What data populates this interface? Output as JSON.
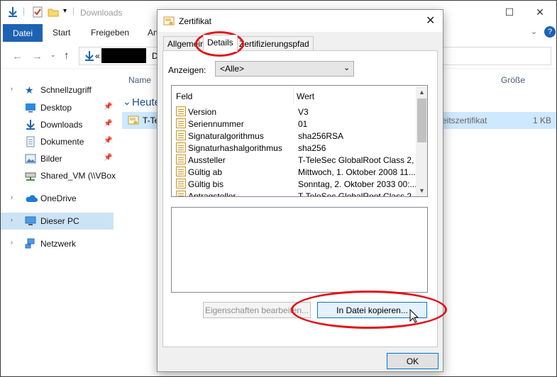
{
  "explorer": {
    "title": "Downloads",
    "ribbon_tabs": [
      "Datei",
      "Start",
      "Freigeben",
      "An"
    ],
    "address_prefix": "«",
    "address_rest": "D",
    "columns": {
      "name": "Name",
      "size": "Größe"
    },
    "group": "Heute",
    "file": {
      "name": "T-Te",
      "type": "eitszertifikat",
      "size": "1 KB"
    },
    "sidebar": [
      {
        "label": "Schnellzugriff",
        "pinned": false
      },
      {
        "label": "Desktop",
        "pinned": true
      },
      {
        "label": "Downloads",
        "pinned": true
      },
      {
        "label": "Dokumente",
        "pinned": true
      },
      {
        "label": "Bilder",
        "pinned": true
      },
      {
        "label": "Shared_VM (\\\\VBox",
        "pinned": false
      },
      {
        "label": "OneDrive",
        "pinned": false
      },
      {
        "label": "Dieser PC",
        "pinned": false
      },
      {
        "label": "Netzwerk",
        "pinned": false
      }
    ],
    "accent": "#1e62b4"
  },
  "dialog": {
    "title": "Zertifikat",
    "tabs": [
      "Allgemein",
      "Details",
      "Zertifizierungspfad"
    ],
    "active_tab": "Details",
    "show_label": "Anzeigen:",
    "show_value": "<Alle>",
    "list_headers": {
      "field": "Feld",
      "value": "Wert"
    },
    "rows": [
      {
        "field": "Version",
        "value": "V3"
      },
      {
        "field": "Seriennummer",
        "value": "01"
      },
      {
        "field": "Signaturalgorithmus",
        "value": "sha256RSA"
      },
      {
        "field": "Signaturhashalgorithmus",
        "value": "sha256"
      },
      {
        "field": "Aussteller",
        "value": "T-TeleSec GlobalRoot Class 2, ..."
      },
      {
        "field": "Gültig ab",
        "value": "Mittwoch, 1. Oktober 2008 11..."
      },
      {
        "field": "Gültig bis",
        "value": "Sonntag, 2. Oktober 2033 00:..."
      },
      {
        "field": "Antragsteller",
        "value": "T-TeleSec GlobalRoot Class 2, ..."
      }
    ],
    "btn_properties": "Eigenschaften bearbeiten...",
    "btn_copy": "In Datei kopieren...",
    "btn_ok": "OK"
  },
  "annotation_color": "#e0141b"
}
